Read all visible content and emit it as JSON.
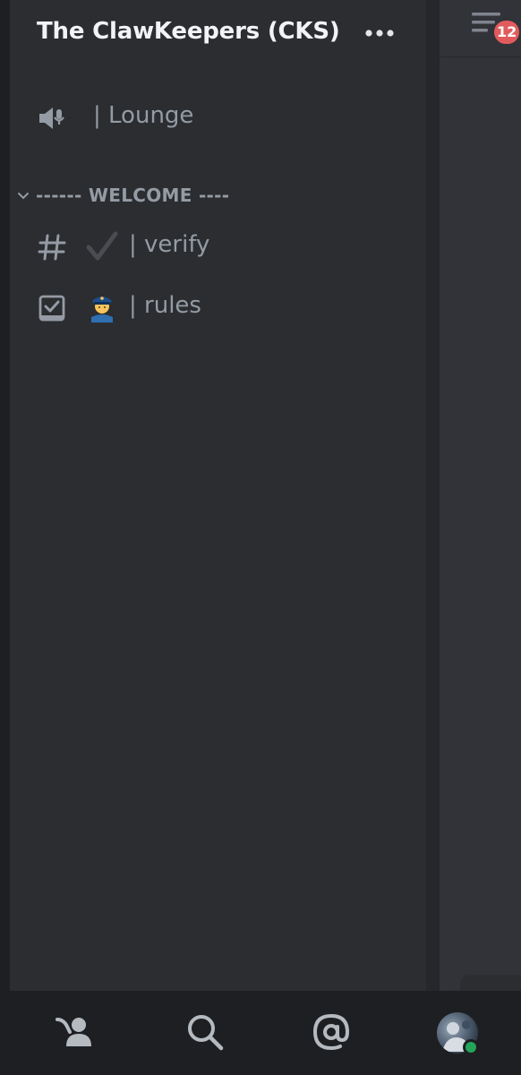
{
  "server": {
    "name": "The ClawKeepers (CKS)"
  },
  "channels": {
    "lounge": {
      "text": "| Lounge",
      "icon": "voice-stage-icon"
    },
    "category": {
      "label": "------ WELCOME ----"
    },
    "verify": {
      "emoji": "✔️",
      "text": "| verify",
      "icon": "hash-icon"
    },
    "rules": {
      "emoji": "👮‍♀️",
      "text": "| rules",
      "icon": "rules-channel-icon"
    }
  },
  "header_right": {
    "threads_icon": "threads-icon",
    "badge_count": "12"
  },
  "bottom_nav": {
    "items": [
      "friends-icon",
      "search-icon",
      "mentions-icon",
      "avatar"
    ]
  },
  "colors": {
    "panel": "#2b2d31",
    "background": "#1e1f22",
    "text_muted": "#949ba4",
    "text_bright": "#f2f3f5",
    "badge": "#e15b5d",
    "status_online": "#23a55a"
  }
}
